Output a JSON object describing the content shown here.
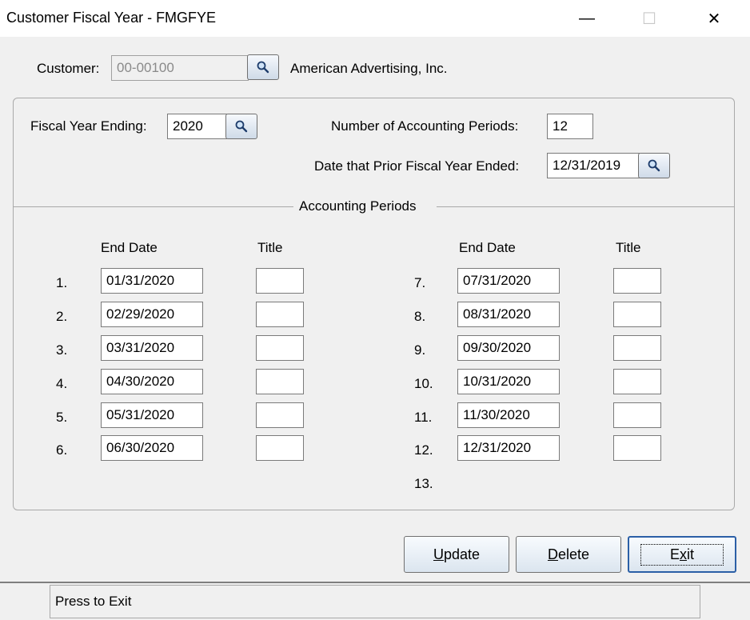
{
  "window": {
    "title": "Customer Fiscal Year - FMGFYE",
    "minimize": "—",
    "maximize": "☐",
    "close": "✕"
  },
  "customer": {
    "label": "Customer:",
    "value": "00-00100",
    "name": "American Advertising, Inc."
  },
  "fiscal": {
    "year_label": "Fiscal Year Ending:",
    "year_value": "2020",
    "periods_label": "Number of Accounting Periods:",
    "periods_value": "12",
    "prior_label": "Date that Prior Fiscal Year Ended:",
    "prior_value": "12/31/2019"
  },
  "section_title": "Accounting Periods",
  "columns": {
    "end_date": "End Date",
    "title": "Title"
  },
  "periods_left": [
    {
      "num": "1.",
      "date": "01/31/2020",
      "title": ""
    },
    {
      "num": "2.",
      "date": "02/29/2020",
      "title": ""
    },
    {
      "num": "3.",
      "date": "03/31/2020",
      "title": ""
    },
    {
      "num": "4.",
      "date": "04/30/2020",
      "title": ""
    },
    {
      "num": "5.",
      "date": "05/31/2020",
      "title": ""
    },
    {
      "num": "6.",
      "date": "06/30/2020",
      "title": ""
    }
  ],
  "periods_right": [
    {
      "num": "7.",
      "date": "07/31/2020",
      "title": ""
    },
    {
      "num": "8.",
      "date": "08/31/2020",
      "title": ""
    },
    {
      "num": "9.",
      "date": "09/30/2020",
      "title": ""
    },
    {
      "num": "10.",
      "date": "10/31/2020",
      "title": ""
    },
    {
      "num": "11.",
      "date": "11/30/2020",
      "title": ""
    },
    {
      "num": "12.",
      "date": "12/31/2020",
      "title": ""
    },
    {
      "num": "13.",
      "date": null,
      "title": null
    }
  ],
  "buttons": {
    "update_hot": "U",
    "update_rest": "pdate",
    "delete_hot": "D",
    "delete_rest": "elete",
    "exit_pre": "E",
    "exit_hot": "x",
    "exit_rest": "it"
  },
  "status": {
    "text": "Press to Exit"
  },
  "icons": {
    "lookup": "magnifier-icon"
  }
}
